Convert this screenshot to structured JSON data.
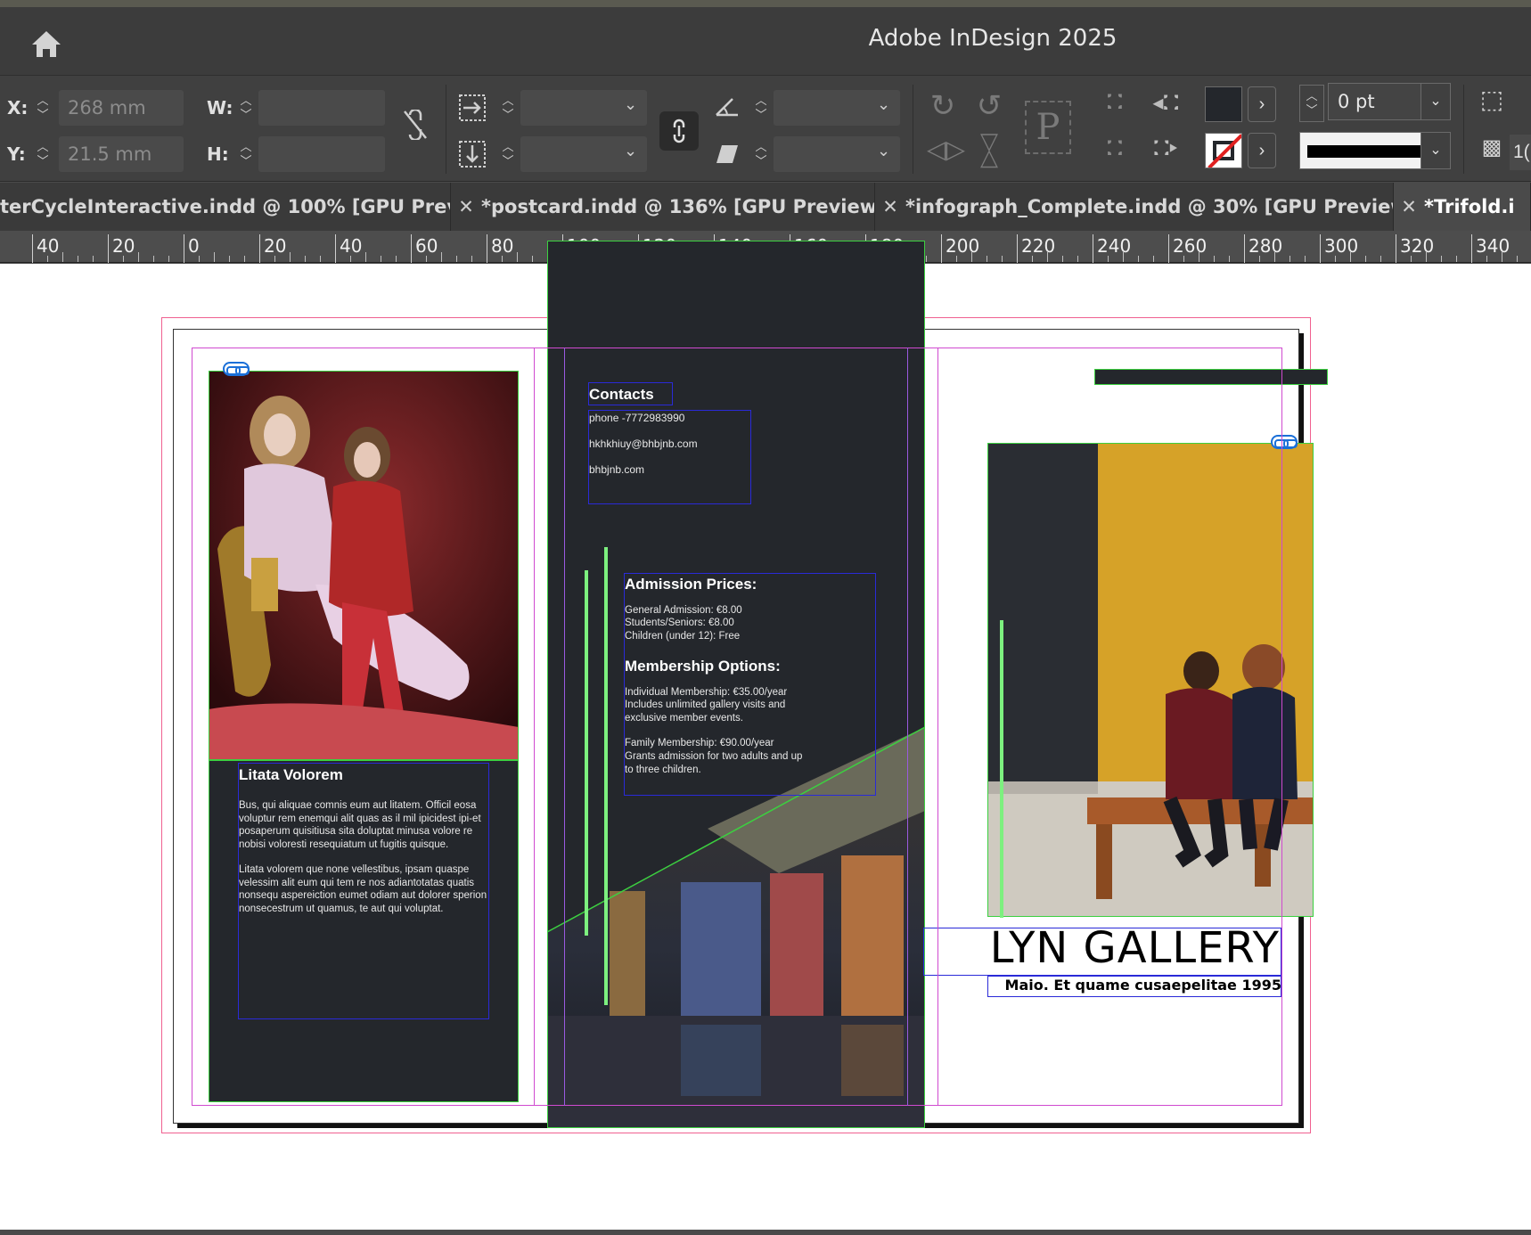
{
  "app": {
    "title": "Adobe InDesign 2025"
  },
  "control_panel": {
    "x_label": "X:",
    "x_value": "268 mm",
    "y_label": "Y:",
    "y_value": "21.5 mm",
    "w_label": "W:",
    "w_value": "",
    "h_label": "H:",
    "h_value": "",
    "stroke_weight": "0 pt",
    "opacity_partial": "1("
  },
  "tabs": [
    {
      "label": "terCycleInteractive.indd @ 100% [GPU Preview]",
      "active": false
    },
    {
      "label": "*postcard.indd @ 136% [GPU Preview]",
      "active": false
    },
    {
      "label": "*infograph_Complete.indd @ 30% [GPU Preview]",
      "active": false
    },
    {
      "label": "*Trifold.i",
      "active": true
    }
  ],
  "ruler": {
    "labels": [
      "40",
      "20",
      "0",
      "20",
      "40",
      "60",
      "80",
      "100",
      "120",
      "140",
      "160",
      "180",
      "200",
      "220",
      "240",
      "260",
      "280",
      "300",
      "320",
      "340"
    ]
  },
  "document": {
    "left_panel": {
      "heading": "Litata Volorem",
      "paragraph1": "Bus, qui aliquae comnis eum aut litatem. Officil eosa voluptur rem enemqui alit quas as il mil ipicidest ipi-et posaperum quisitiusa sita doluptat minusa volore re nobisi voloresti resequiatum ut fugitis quisque.",
      "paragraph2": "Litata volorem que none vellestibus, ipsam quaspe velessim alit eum qui tem re nos adiantotatas quatis nonsequ aspereiction eumet odiam aut dolorer sperion nonsecestrum ut quamus, te aut qui voluptat."
    },
    "contacts": {
      "heading": "Contacts",
      "phone": "phone -7772983990",
      "email": "hkhkhiuy@bhbjnb.com",
      "web": "bhbjnb.com"
    },
    "prices": {
      "heading": "Admission Prices:",
      "general": "General Admission: €8.00",
      "students": "Students/Seniors: €8.00",
      "children": "Children (under 12): Free",
      "membership_heading": "Membership Options:",
      "individual": "Individual Membership: €35.00/year",
      "individual_desc": "Includes unlimited gallery visits and exclusive member events.",
      "family": "Family Membership: €90.00/year",
      "family_desc": "Grants admission for two adults and up to three children."
    },
    "cover": {
      "title": "LYN GALLERY",
      "subtitle": "Maio. Et quame cusaepelitae 1995"
    }
  },
  "colors": {
    "dark_panel": "#24272c",
    "frame_green": "#3cd040",
    "guide_magenta": "#d04ad0",
    "frame_blue": "#2a2ad8",
    "accent_bar": "#7df07f"
  }
}
